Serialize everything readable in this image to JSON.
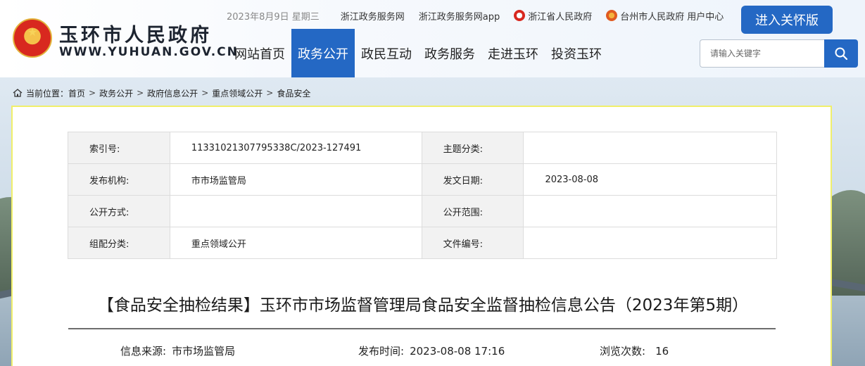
{
  "header": {
    "site_name": "玉环市人民政府",
    "site_domain": "WWW.YUHUAN.GOV.CN",
    "date": "2023年8月9日 星期三",
    "top_links": [
      "浙江政务服务网",
      "浙江政务服务网app",
      "浙江省人民政府",
      "台州市人民政府",
      "用户中心"
    ],
    "care_mode": "进入关怀版",
    "search_placeholder": "请输入关键字"
  },
  "nav": {
    "items": [
      "网站首页",
      "政务公开",
      "政民互动",
      "政务服务",
      "走进玉环",
      "投资玉环"
    ],
    "active_index": 1
  },
  "breadcrumb": {
    "label": "当前位置：",
    "items": [
      "首页",
      "政务公开",
      "政府信息公开",
      "重点领域公开",
      "食品安全"
    ]
  },
  "meta": {
    "rows": [
      {
        "k1": "索引号:",
        "v1": "11331021307795338C/2023-127491",
        "k2": "主题分类:",
        "v2": ""
      },
      {
        "k1": "发布机构:",
        "v1": "市市场监管局",
        "k2": "发文日期:",
        "v2": "2023-08-08"
      },
      {
        "k1": "公开方式:",
        "v1": "",
        "k2": "公开范围:",
        "v2": ""
      },
      {
        "k1": "组配分类:",
        "v1": "重点领域公开",
        "k2": "文件编号:",
        "v2": ""
      }
    ]
  },
  "article": {
    "title": "【食品安全抽检结果】玉环市市场监督管理局食品安全监督抽检信息公告（2023年第5期）",
    "source_label": "信息来源:",
    "source_value": "市市场监管局",
    "time_label": "发布时间:",
    "time_value": "2023-08-08 17:16",
    "views_label": "浏览次数:",
    "views_value": "16"
  },
  "colors": {
    "accent": "#2468c4",
    "panel_border": "#f0ef6a"
  }
}
